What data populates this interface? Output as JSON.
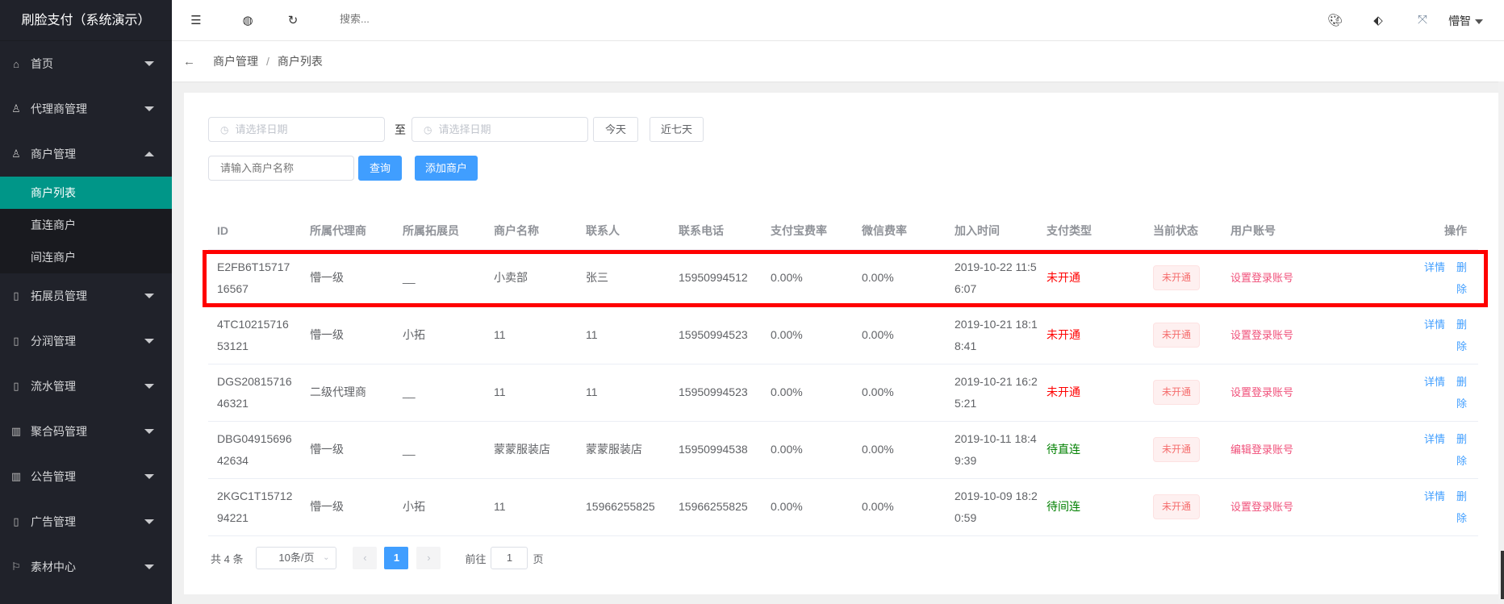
{
  "app": {
    "title": "刷脸支付（系统演示）"
  },
  "sidebar": {
    "items": [
      {
        "label": "首页",
        "icon": "home-icon",
        "glyph": "⌂",
        "expanded": false
      },
      {
        "label": "代理商管理",
        "icon": "user-icon",
        "glyph": "♙",
        "expanded": false
      },
      {
        "label": "商户管理",
        "icon": "user-icon",
        "glyph": "♙",
        "expanded": true,
        "children": [
          "商户列表",
          "直连商户",
          "间连商户"
        ]
      },
      {
        "label": "拓展员管理",
        "icon": "clipboard-icon",
        "glyph": "▯"
      },
      {
        "label": "分润管理",
        "icon": "clipboard-icon",
        "glyph": "▯"
      },
      {
        "label": "流水管理",
        "icon": "clipboard-icon",
        "glyph": "▯"
      },
      {
        "label": "聚合码管理",
        "icon": "book-icon",
        "glyph": "▥"
      },
      {
        "label": "公告管理",
        "icon": "book-icon",
        "glyph": "▥"
      },
      {
        "label": "广告管理",
        "icon": "clipboard-icon",
        "glyph": "▯"
      },
      {
        "label": "素材中心",
        "icon": "flag-icon",
        "glyph": "⚐"
      }
    ]
  },
  "header": {
    "search_placeholder": "搜索...",
    "user": "懵智"
  },
  "breadcrumb": [
    "商户管理",
    "商户列表"
  ],
  "filters": {
    "date_placeholder": "请选择日期",
    "to": "至",
    "today": "今天",
    "last7": "近七天",
    "name_placeholder": "请输入商户名称",
    "query": "查询",
    "add": "添加商户"
  },
  "table": {
    "headers": [
      "ID",
      "所属代理商",
      "所属拓展员",
      "商户名称",
      "联系人",
      "联系电话",
      "支付宝费率",
      "微信费率",
      "加入时间",
      "支付类型",
      "当前状态",
      "用户账号",
      "操作"
    ],
    "rows": [
      {
        "id": "E2FB6T1571716567",
        "agent": "懵一级",
        "expander": "__",
        "name": "小卖部",
        "contact": "张三",
        "phone": "15950994512",
        "alipay": "0.00%",
        "wechat": "0.00%",
        "joined": "2019-10-22 11:56:07",
        "paytype": "未开通",
        "paytype_color": "red",
        "status": "未开通",
        "account": "设置登录账号"
      },
      {
        "id": "4TC1021571653121",
        "agent": "懵一级",
        "expander": "小拓",
        "name": "11",
        "contact": "11",
        "phone": "15950994523",
        "alipay": "0.00%",
        "wechat": "0.00%",
        "joined": "2019-10-21 18:18:41",
        "paytype": "未开通",
        "paytype_color": "red",
        "status": "未开通",
        "account": "设置登录账号"
      },
      {
        "id": "DGS2081571646321",
        "agent": "二级代理商",
        "expander": "__",
        "name": "11",
        "contact": "11",
        "phone": "15950994523",
        "alipay": "0.00%",
        "wechat": "0.00%",
        "joined": "2019-10-21 16:25:21",
        "paytype": "未开通",
        "paytype_color": "red",
        "status": "未开通",
        "account": "设置登录账号"
      },
      {
        "id": "DBG0491569642634",
        "agent": "懵一级",
        "expander": "__",
        "name": "蒙蒙服装店",
        "contact": "蒙蒙服装店",
        "phone": "15950994538",
        "alipay": "0.00%",
        "wechat": "0.00%",
        "joined": "2019-10-11 18:49:39",
        "paytype": "待直连",
        "paytype_color": "green",
        "status": "未开通",
        "account": "编辑登录账号"
      },
      {
        "id": "2KGC1T1571294221",
        "agent": "懵一级",
        "expander": "小拓",
        "name": "11",
        "contact": "15966255825",
        "phone": "15966255825",
        "alipay": "0.00%",
        "wechat": "0.00%",
        "joined": "2019-10-09 18:20:59",
        "paytype": "待间连",
        "paytype_color": "green",
        "status": "未开通",
        "account": "设置登录账号"
      }
    ],
    "detail": "详情",
    "delete": "删除"
  },
  "pagination": {
    "total": "共 4 条",
    "page_size": "10条/页",
    "current": "1",
    "goto": "前往",
    "goto_value": "1",
    "page_suffix": "页"
  }
}
